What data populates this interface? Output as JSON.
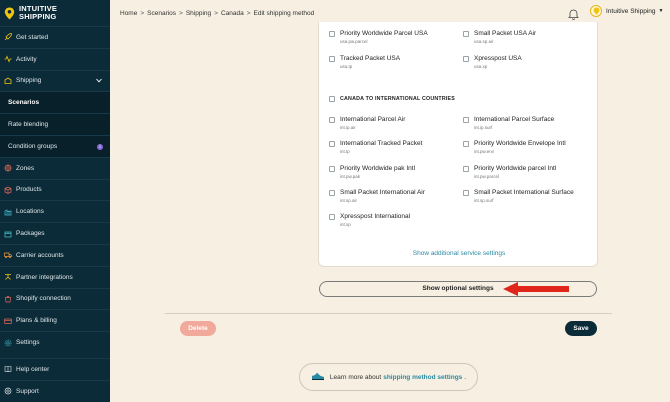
{
  "brand": {
    "line1": "INTUITIVE",
    "line2": "SHIPPING"
  },
  "breadcrumb": [
    "Home",
    "Scenarios",
    "Shipping",
    "Canada",
    "Edit shipping method"
  ],
  "account": {
    "name": "Intuitive Shipping"
  },
  "sidebar": {
    "items": [
      {
        "label": "Get started",
        "icon": "rocket-icon"
      },
      {
        "label": "Activity",
        "icon": "activity-icon"
      },
      {
        "label": "Shipping",
        "icon": "shipping-icon"
      },
      {
        "label": "Scenarios"
      },
      {
        "label": "Rate blending"
      },
      {
        "label": "Condition groups",
        "badge": "i"
      },
      {
        "label": "Zones",
        "icon": "zones-icon"
      },
      {
        "label": "Products",
        "icon": "products-icon"
      },
      {
        "label": "Locations",
        "icon": "locations-icon"
      },
      {
        "label": "Packages",
        "icon": "packages-icon"
      },
      {
        "label": "Carrier accounts",
        "icon": "carrier-icon"
      },
      {
        "label": "Partner integrations",
        "icon": "integrations-icon"
      },
      {
        "label": "Shopify connection",
        "icon": "shopify-icon"
      },
      {
        "label": "Plans & billing",
        "icon": "billing-icon"
      },
      {
        "label": "Settings",
        "icon": "gear-icon"
      }
    ],
    "bottom": [
      {
        "label": "Help center",
        "icon": "help-icon"
      },
      {
        "label": "Support",
        "icon": "support-icon"
      }
    ]
  },
  "card": {
    "usa_options": [
      {
        "label": "Priority Worldwide Parcel USA",
        "code": "usa.pw.parcel"
      },
      {
        "label": "Small Packet USA Air",
        "code": "usa.sp.air"
      },
      {
        "label": "Tracked Packet USA",
        "code": "usa.tp"
      },
      {
        "label": "Xpresspost USA",
        "code": "usa.xp"
      }
    ],
    "section_title": "CANADA TO INTERNATIONAL COUNTRIES",
    "intl_options": [
      {
        "label": "International Parcel Air",
        "code": "int.ip.air"
      },
      {
        "label": "International Parcel Surface",
        "code": "int.ip.surf"
      },
      {
        "label": "International Tracked Packet",
        "code": "int.tp"
      },
      {
        "label": "Priority Worldwide Envelope Intl",
        "code": "int.pw.env"
      },
      {
        "label": "Priority Worldwide pak Intl",
        "code": "int.pw.pak"
      },
      {
        "label": "Priority Worldwide parcel Intl",
        "code": "int.pw.parcel"
      },
      {
        "label": "Small Packet International Air",
        "code": "int.sp.air"
      },
      {
        "label": "Small Packet International Surface",
        "code": "int.sp.surf"
      },
      {
        "label": "Xpresspost International",
        "code": "int.xp"
      }
    ],
    "additional_link": "Show additional service settings"
  },
  "optional_button": "Show optional settings",
  "actions": {
    "delete": "Delete",
    "save": "Save"
  },
  "learn": {
    "prefix": "Learn more about",
    "link": "shipping method settings",
    "suffix": "."
  },
  "colors": {
    "sidebar_bg": "#0c2b38",
    "page_bg": "#f6efe2",
    "accent_link": "#2b8aa3",
    "arrow": "#e0251b",
    "delete_bg": "#f0a99a"
  }
}
